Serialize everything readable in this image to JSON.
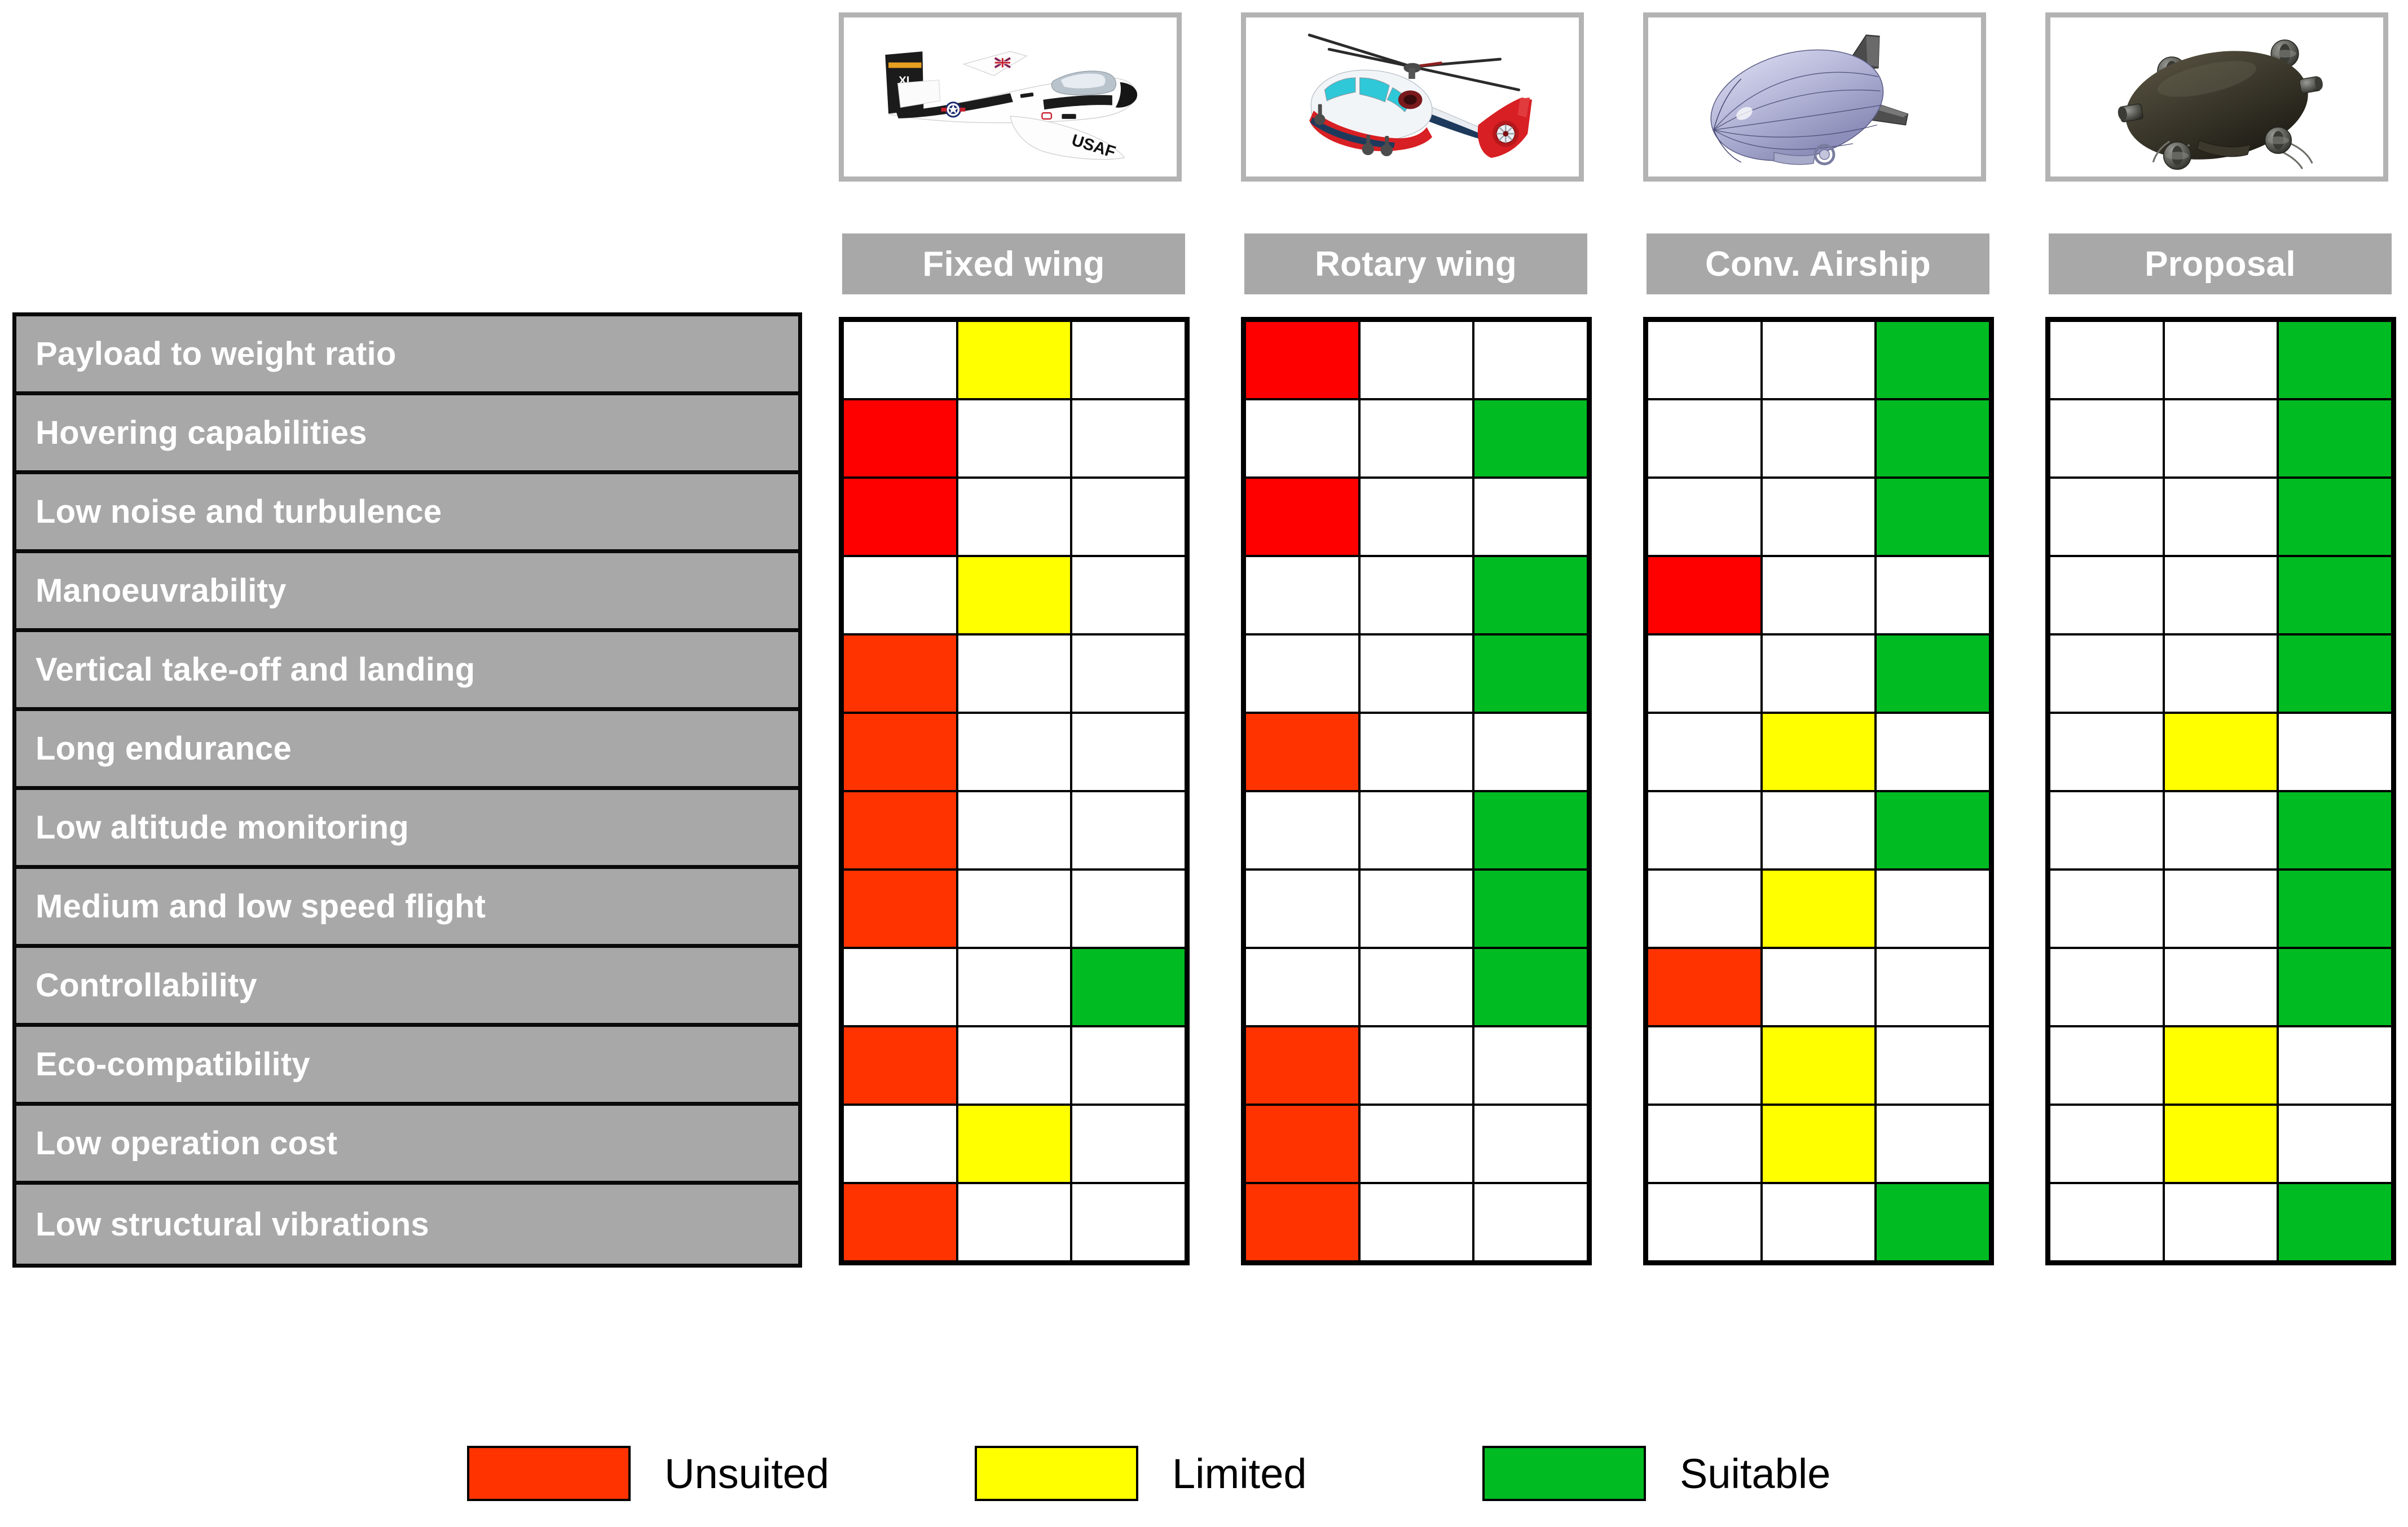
{
  "columns": [
    {
      "label": "Fixed wing",
      "thumbnail_icon": "fixed-wing-aircraft-photo"
    },
    {
      "label": "Rotary wing",
      "thumbnail_icon": "helicopter-photo"
    },
    {
      "label": "Conv. Airship",
      "thumbnail_icon": "conventional-airship-render"
    },
    {
      "label": "Proposal",
      "thumbnail_icon": "proposal-airship-render"
    }
  ],
  "criteria": [
    "Payload to weight ratio",
    "Hovering capabilities",
    "Low noise and turbulence",
    "Manoeuvrability",
    "Vertical take-off and landing",
    "Long endurance",
    "Low altitude monitoring",
    "Medium and low speed flight",
    "Controllability",
    "Eco-compatibility",
    "Low operation cost",
    "Low structural vibrations"
  ],
  "legend": [
    {
      "label": "Unsuited",
      "color": "#ff3300"
    },
    {
      "label": "Limited",
      "color": "#ffff00"
    },
    {
      "label": "Suitable",
      "color": "#00bb22"
    }
  ],
  "colors": {
    "unsuited": "#ff3300",
    "unsuited_bright": "#ff0000",
    "limited": "#ffff00",
    "suitable": "#00bb22",
    "panel_gray": "#a8a8a8",
    "header_gray": "#a8a8a8",
    "border_black": "#000000",
    "thumb_border_gray": "#b3b3b3"
  },
  "chart_data": {
    "type": "heatmap",
    "title": "",
    "xlabel": "",
    "ylabel": "",
    "categories": [
      "Payload to weight ratio",
      "Hovering capabilities",
      "Low noise and turbulence",
      "Manoeuvrability",
      "Vertical take-off and landing",
      "Long endurance",
      "Low altitude monitoring",
      "Medium and low speed flight",
      "Controllability",
      "Eco-compatibility",
      "Low operation cost",
      "Low structural vibrations"
    ],
    "columns": [
      "Fixed wing",
      "Rotary wing",
      "Conv. Airship",
      "Proposal"
    ],
    "rating_scale": [
      "Unsuited",
      "Limited",
      "Suitable"
    ],
    "cells_per_row": 3,
    "legend_position": "bottom-center",
    "grid": true,
    "series": [
      {
        "name": "Fixed wing",
        "values": [
          "Limited",
          "Unsuited",
          "Unsuited",
          "Limited",
          "Unsuited",
          "Unsuited",
          "Unsuited",
          "Unsuited",
          "Suitable",
          "Unsuited",
          "Limited",
          "Unsuited"
        ],
        "cell_shades": [
          "limited",
          "unsuited_bright",
          "unsuited_bright",
          "limited",
          "unsuited",
          "unsuited",
          "unsuited",
          "unsuited",
          "suitable",
          "unsuited",
          "limited",
          "unsuited"
        ]
      },
      {
        "name": "Rotary wing",
        "values": [
          "Unsuited",
          "Suitable",
          "Unsuited",
          "Suitable",
          "Suitable",
          "Unsuited",
          "Suitable",
          "Suitable",
          "Suitable",
          "Unsuited",
          "Unsuited",
          "Unsuited"
        ],
        "cell_shades": [
          "unsuited_bright",
          "suitable",
          "unsuited_bright",
          "suitable",
          "suitable",
          "unsuited",
          "suitable",
          "suitable",
          "suitable",
          "unsuited",
          "unsuited",
          "unsuited"
        ]
      },
      {
        "name": "Conv. Airship",
        "values": [
          "Suitable",
          "Suitable",
          "Suitable",
          "Unsuited",
          "Suitable",
          "Limited",
          "Suitable",
          "Limited",
          "Unsuited",
          "Limited",
          "Limited",
          "Suitable"
        ],
        "cell_shades": [
          "suitable",
          "suitable",
          "suitable",
          "unsuited_bright",
          "suitable",
          "limited",
          "suitable",
          "limited",
          "unsuited",
          "limited",
          "limited",
          "suitable"
        ]
      },
      {
        "name": "Proposal",
        "values": [
          "Suitable",
          "Suitable",
          "Suitable",
          "Suitable",
          "Suitable",
          "Limited",
          "Suitable",
          "Suitable",
          "Suitable",
          "Limited",
          "Limited",
          "Suitable"
        ],
        "cell_shades": [
          "suitable",
          "suitable",
          "suitable",
          "suitable",
          "suitable",
          "limited",
          "suitable",
          "suitable",
          "suitable",
          "limited",
          "limited",
          "suitable"
        ]
      }
    ]
  }
}
